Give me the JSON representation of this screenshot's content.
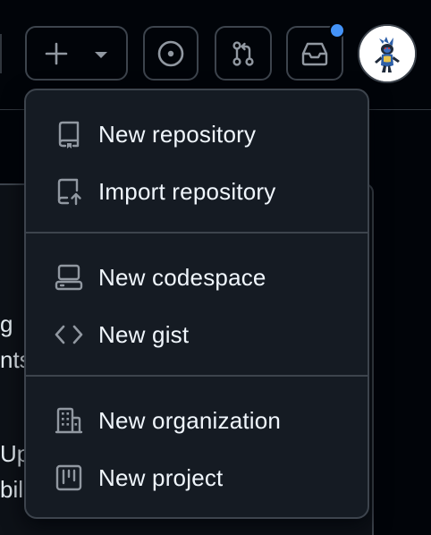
{
  "header": {
    "create_button_label": "",
    "icons": {
      "create": "plus-icon",
      "create_caret": "triangle-down-icon",
      "issues": "issue-opened-icon",
      "pulls": "git-pull-request-icon",
      "inbox": "inbox-icon"
    },
    "notification_indicator_color": "#4493f8"
  },
  "create_menu": {
    "groups": [
      {
        "items": [
          {
            "label": "New repository",
            "icon": "repo-icon"
          },
          {
            "label": "Import repository",
            "icon": "repo-push-icon"
          }
        ]
      },
      {
        "items": [
          {
            "label": "New codespace",
            "icon": "codespaces-icon"
          },
          {
            "label": "New gist",
            "icon": "code-icon"
          }
        ]
      },
      {
        "items": [
          {
            "label": "New organization",
            "icon": "organization-icon"
          },
          {
            "label": "New project",
            "icon": "table-icon"
          }
        ]
      }
    ]
  },
  "background": {
    "fragments": [
      "g p",
      "nts",
      "Up",
      "bili"
    ]
  },
  "colors": {
    "page_bg": "#010409",
    "menu_bg": "#151b23",
    "border": "#3d444d",
    "text": "#f0f6fc",
    "icon": "#9198a1"
  }
}
